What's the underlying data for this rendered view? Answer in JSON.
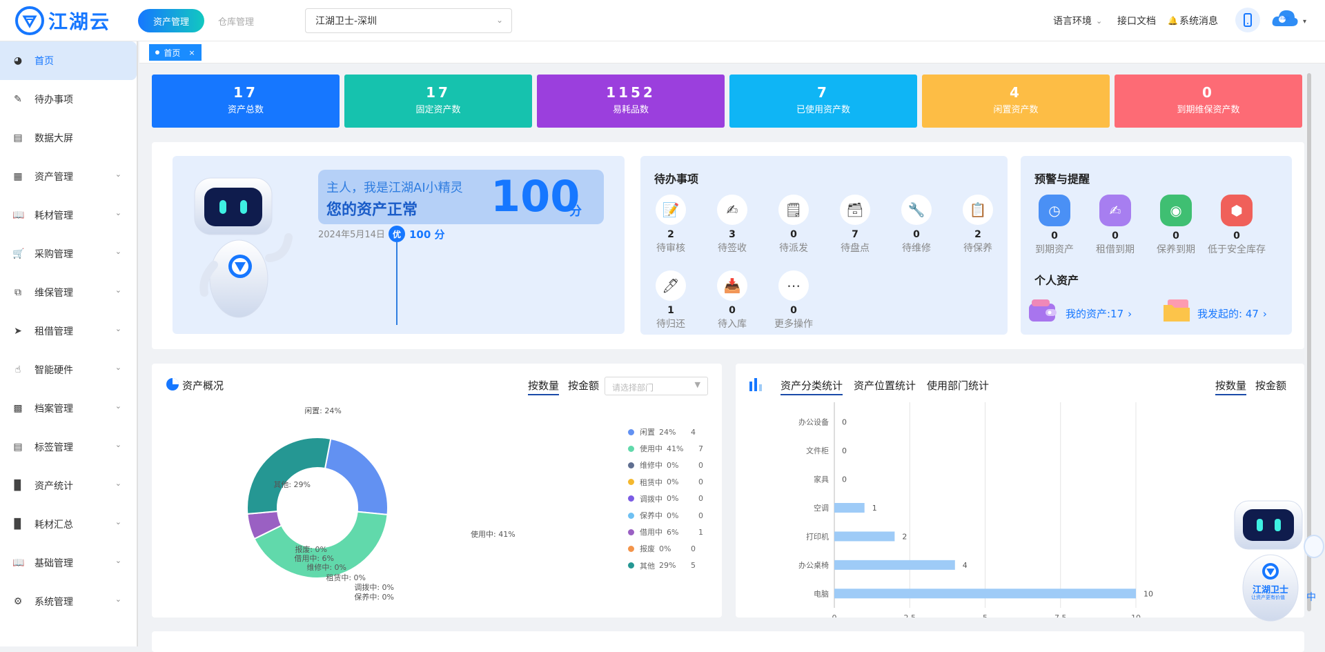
{
  "header": {
    "logo_text": "江湖云",
    "nav_active": "资产管理",
    "nav_inactive": "仓库管理",
    "org_select": "江湖卫士-深圳",
    "language": "语言环境",
    "api_docs": "接口文档",
    "system_msg": "系统消息",
    "avatar_text": "江湖云"
  },
  "sidebar": {
    "items": [
      {
        "label": "首页",
        "icon": "dashboard-icon"
      },
      {
        "label": "待办事项",
        "icon": "edit-icon"
      },
      {
        "label": "数据大屏",
        "icon": "monitor-icon"
      },
      {
        "label": "资产管理",
        "icon": "grid-icon"
      },
      {
        "label": "耗材管理",
        "icon": "book-icon"
      },
      {
        "label": "采购管理",
        "icon": "cart-icon"
      },
      {
        "label": "维保管理",
        "icon": "copy-icon"
      },
      {
        "label": "租借管理",
        "icon": "send-icon"
      },
      {
        "label": "智能硬件",
        "icon": "hand-icon"
      },
      {
        "label": "档案管理",
        "icon": "archive-icon"
      },
      {
        "label": "标签管理",
        "icon": "tag-icon"
      },
      {
        "label": "资产统计",
        "icon": "bar-chart-icon"
      },
      {
        "label": "耗材汇总",
        "icon": "bar-chart-icon"
      },
      {
        "label": "基础管理",
        "icon": "book-icon"
      },
      {
        "label": "系统管理",
        "icon": "gear-icon"
      }
    ]
  },
  "tabs": {
    "home": "首页",
    "close": "×"
  },
  "stats": [
    {
      "num": "17",
      "label": "资产总数",
      "color": "#1677ff"
    },
    {
      "num": "17",
      "label": "固定资产数",
      "color": "#16c2ae"
    },
    {
      "num": "1152",
      "label": "易耗品数",
      "color": "#9b3fdd"
    },
    {
      "num": "7",
      "label": "已使用资产数",
      "color": "#0fb5f5"
    },
    {
      "num": "4",
      "label": "闲置资产数",
      "color": "#fdbd45"
    },
    {
      "num": "0",
      "label": "到期维保资产数",
      "color": "#fd6b75"
    }
  ],
  "robot": {
    "greeting": "主人，我是江湖AI小精灵",
    "status": "您的资产正常",
    "score": "100",
    "score_unit": "分",
    "date": "2024年5月14日",
    "grade": "优",
    "grade_score": "100 分"
  },
  "todo": {
    "title": "待办事项",
    "items": [
      {
        "num": "2",
        "label": "待审核"
      },
      {
        "num": "3",
        "label": "待签收"
      },
      {
        "num": "0",
        "label": "待派发"
      },
      {
        "num": "7",
        "label": "待盘点"
      },
      {
        "num": "0",
        "label": "待维修"
      },
      {
        "num": "2",
        "label": "待保养"
      },
      {
        "num": "1",
        "label": "待归还"
      },
      {
        "num": "0",
        "label": "待入库"
      },
      {
        "num": "0",
        "label": "更多操作"
      }
    ]
  },
  "warning": {
    "title": "预警与提醒",
    "items": [
      {
        "num": "0",
        "label": "到期资产",
        "color": "#4a90f5"
      },
      {
        "num": "0",
        "label": "租借到期",
        "color": "#a77ef0"
      },
      {
        "num": "0",
        "label": "保养到期",
        "color": "#3fbf72"
      },
      {
        "num": "0",
        "label": "低于安全库存",
        "color": "#f0605a"
      }
    ],
    "personal_title": "个人资产",
    "my_assets": "我的资产:17",
    "my_initiated": "我发起的:  47"
  },
  "overview": {
    "title": "资产概况",
    "tab_count": "按数量",
    "tab_amount": "按金额",
    "dept_placeholder": "请选择部门"
  },
  "category": {
    "tabs": [
      "资产分类统计",
      "资产位置统计",
      "使用部门统计"
    ],
    "tab_count": "按数量",
    "tab_amount": "按金额"
  },
  "chart_data": [
    {
      "type": "pie",
      "donut": true,
      "slices": [
        {
          "name": "闲置",
          "percent": 24,
          "value": 4,
          "color": "#6291f2",
          "label": "闲置: 24%"
        },
        {
          "name": "使用中",
          "percent": 41,
          "value": 7,
          "color": "#61d9ab",
          "label": "使用中: 41%"
        },
        {
          "name": "维修中",
          "percent": 0,
          "value": 0,
          "color": "#5f6e90",
          "label": "维修中: 0%"
        },
        {
          "name": "租赁中",
          "percent": 0,
          "value": 0,
          "color": "#f4b82e",
          "label": "租赁中: 0%"
        },
        {
          "name": "调拨中",
          "percent": 0,
          "value": 0,
          "color": "#7b5be4",
          "label": "调拨中: 0%"
        },
        {
          "name": "保养中",
          "percent": 0,
          "value": 0,
          "color": "#6ec0f2",
          "label": "保养中: 0%"
        },
        {
          "name": "借用中",
          "percent": 6,
          "value": 1,
          "color": "#9a60c3",
          "label": "借用中: 6%"
        },
        {
          "name": "报废",
          "percent": 0,
          "value": 0,
          "color": "#f3944a",
          "label": "报废: 0%"
        },
        {
          "name": "其他",
          "percent": 29,
          "value": 5,
          "color": "#259793",
          "label": "其他: 29%"
        }
      ],
      "legend": [
        {
          "name": "闲置",
          "pct": "24%",
          "count": "4"
        },
        {
          "name": "使用中",
          "pct": "41%",
          "count": "7"
        },
        {
          "name": "维修中",
          "pct": "0%",
          "count": "0"
        },
        {
          "name": "租赁中",
          "pct": "0%",
          "count": "0"
        },
        {
          "name": "调拨中",
          "pct": "0%",
          "count": "0"
        },
        {
          "name": "保养中",
          "pct": "0%",
          "count": "0"
        },
        {
          "name": "借用中",
          "pct": "6%",
          "count": "1"
        },
        {
          "name": "报废",
          "pct": "0%",
          "count": "0"
        },
        {
          "name": "其他",
          "pct": "29%",
          "count": "5"
        }
      ]
    },
    {
      "type": "bar",
      "orientation": "horizontal",
      "categories": [
        "办公设备",
        "文件柜",
        "家具",
        "空调",
        "打印机",
        "办公桌椅",
        "电脑"
      ],
      "values": [
        0,
        0,
        0,
        1,
        2,
        4,
        10
      ],
      "xlim": [
        0,
        10
      ],
      "xticks": [
        "0",
        "2.5",
        "5",
        "7.5",
        "10"
      ],
      "bar_color": "#9ecbf7",
      "grid": true
    }
  ],
  "helper": {
    "label": "江湖卫士",
    "sub": "让资产更有价值",
    "cut_text": "中"
  }
}
